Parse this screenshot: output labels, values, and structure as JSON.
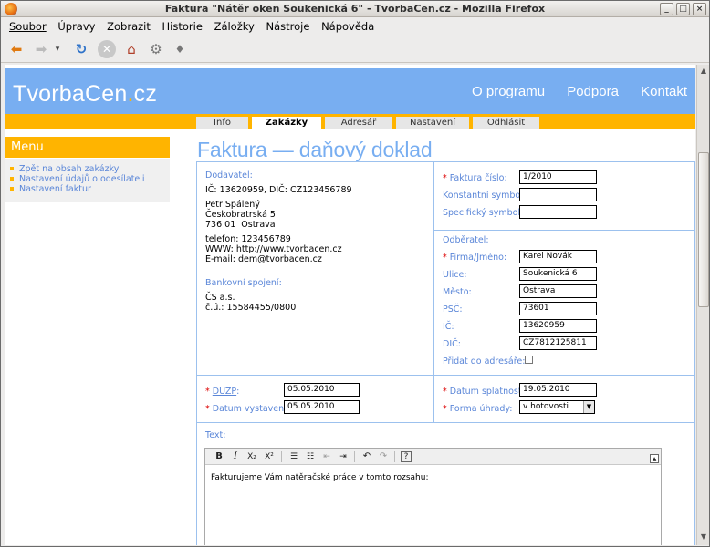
{
  "window": {
    "title": "Faktura \"Nátěr oken Soukenická 6\" - TvorbaCen.cz - Mozilla Firefox"
  },
  "menubar": [
    "Soubor",
    "Úpravy",
    "Zobrazit",
    "Historie",
    "Záložky",
    "Nástroje",
    "Nápověda"
  ],
  "site": {
    "logo_main": "TvorbaCen",
    "logo_dot": ".",
    "logo_tld": "cz",
    "nav": [
      "O programu",
      "Podpora",
      "Kontakt"
    ],
    "tabs": [
      "Info",
      "Zakázky",
      "Adresář",
      "Nastavení",
      "Odhlásit"
    ],
    "active_tab": "Zakázky"
  },
  "sidebar": {
    "title": "Menu",
    "items": [
      "Zpět na obsah zakázky",
      "Nastavení údajů o odesílateli",
      "Nastavení faktur"
    ]
  },
  "page": {
    "title": "Faktura — daňový doklad"
  },
  "supplier": {
    "heading": "Dodavatel:",
    "ids": "IČ: 13620959, DIČ: CZ123456789",
    "name": "Petr Spálený",
    "street": "Českobratrská 5",
    "city": "736 01  Ostrava",
    "phone": "telefon: 123456789",
    "www": "WWW: http://www.tvorbacen.cz",
    "email": "E-mail: dem@tvorbacen.cz",
    "bank_heading": "Bankovní spojení:",
    "bank": "ČS a.s.",
    "account": "č.ú.: 15584455/0800"
  },
  "invoice": {
    "number_label": "Faktura číslo:",
    "number": "1/2010",
    "const_label": "Konstantní symbol:",
    "const": "",
    "spec_label": "Specifický symbol:",
    "spec": ""
  },
  "customer": {
    "heading": "Odběratel:",
    "firm_label": "Firma/Jméno:",
    "firm": "Karel Novák",
    "street_label": "Ulice:",
    "street": "Soukenická 6",
    "city_label": "Město:",
    "city": "Ostrava",
    "zip_label": "PSČ:",
    "zip": "73601",
    "ic_label": "IČ:",
    "ic": "13620959",
    "dic_label": "DIČ:",
    "dic": "CZ7812125811",
    "add_label": "Přidat do adresáře:"
  },
  "dates": {
    "duzp_label": "DUZP",
    "duzp_suffix": ":",
    "duzp": "05.05.2010",
    "issued_label": "Datum vystavení:",
    "issued": "05.05.2010",
    "due_label": "Datum splatnosti:",
    "due": "19.05.2010",
    "payment_label": "Forma úhrady:",
    "payment": "v hotovosti"
  },
  "text": {
    "label": "Text:",
    "content": "Fakturujeme Vám natěračské práce v tomto rozsahu:"
  },
  "colors": {
    "accent_blue": "#78aef1",
    "accent_orange": "#ffb400",
    "link_blue": "#5a86d8",
    "required_red": "#dd0000"
  }
}
